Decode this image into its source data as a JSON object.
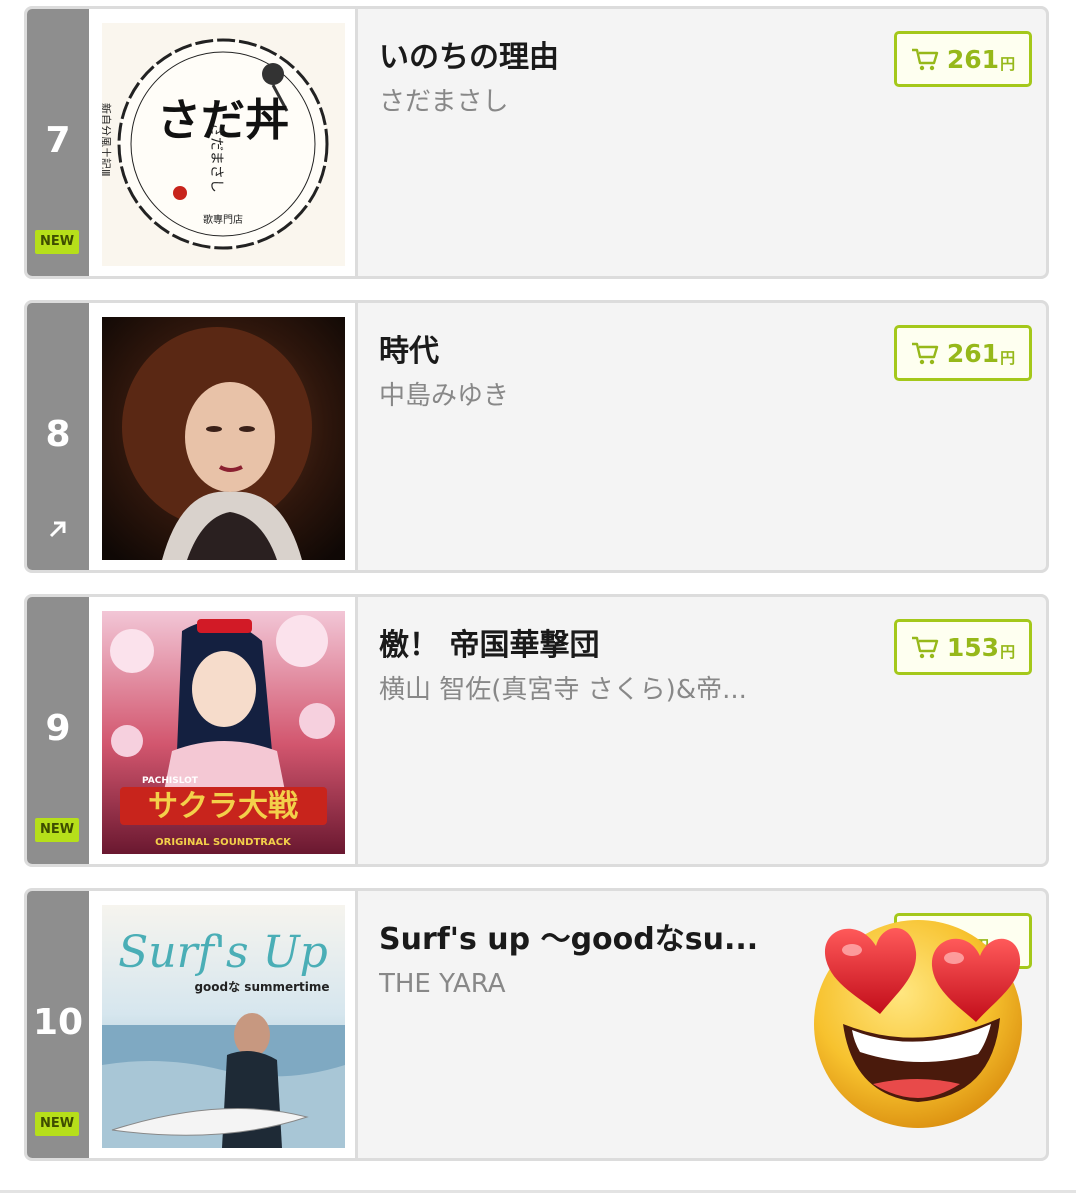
{
  "rankings": [
    {
      "rank": "7",
      "badge": "NEW",
      "title": "いのちの理由",
      "artist": "さだまさし",
      "price": "261",
      "currency": "円",
      "jacket_text": {
        "main": "さだ丼",
        "side": "さだまさし",
        "sub": "新自分風土記Ⅲ",
        "shop": "歌專門店"
      }
    },
    {
      "rank": "8",
      "trend": "up-arrow-icon",
      "title": "時代",
      "artist": "中島みゆき",
      "price": "261",
      "currency": "円"
    },
    {
      "rank": "9",
      "badge": "NEW",
      "title": "檄！ 帝国華撃団",
      "artist": "横山 智佐(真宮寺 さくら)&帝...",
      "price": "153",
      "currency": "円",
      "jacket_text": {
        "main": "サクラ大戦",
        "top": "PACHISLOT",
        "band": "ORIGINAL SOUNDTRACK"
      }
    },
    {
      "rank": "10",
      "badge": "NEW",
      "title": "Surf's up ～goodなsu...",
      "artist": "THE YARA",
      "price": "",
      "currency": "円",
      "jacket_text": {
        "main": "Surf's Up",
        "sub": "goodな summertime"
      }
    }
  ],
  "overlay": {
    "icon": "heart-eyes-emoji-icon"
  },
  "colors": {
    "accent": "#a4c81a",
    "rank_bg": "#8e8e8e",
    "new_badge": "#b6df1a"
  }
}
